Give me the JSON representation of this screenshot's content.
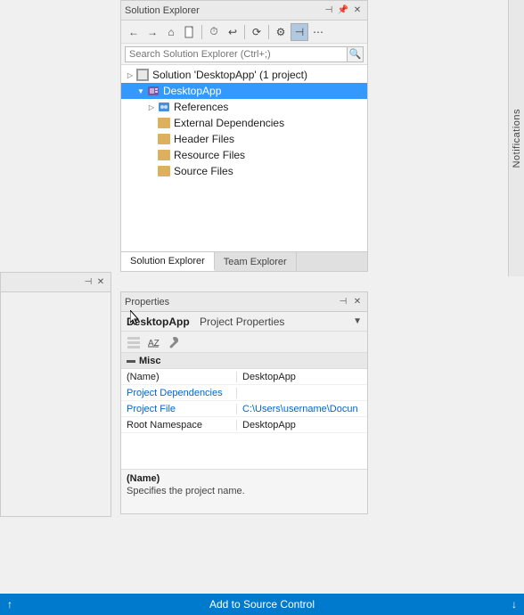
{
  "notifications": {
    "label": "Notifications"
  },
  "solutionExplorer": {
    "title": "Solution Explorer",
    "searchPlaceholder": "Search Solution Explorer (Ctrl+;)",
    "tree": {
      "solution": "Solution 'DesktopApp' (1 project)",
      "project": "DesktopApp",
      "references": "References",
      "externalDependencies": "External Dependencies",
      "headerFiles": "Header Files",
      "resourceFiles": "Resource Files",
      "sourceFiles": "Source Files"
    },
    "tabs": {
      "solutionExplorer": "Solution Explorer",
      "teamExplorer": "Team Explorer"
    }
  },
  "properties": {
    "panelTitle": "Properties",
    "objectName": "DesktopApp",
    "objectType": "Project Properties",
    "misc": {
      "label": "Misc",
      "name": {
        "key": "(Name)",
        "value": "DesktopApp"
      },
      "projectDependencies": {
        "key": "Project Dependencies",
        "value": ""
      },
      "projectFile": {
        "key": "Project File",
        "value": "C:\\Users\\username\\Docun"
      },
      "rootNamespace": {
        "key": "Root Namespace",
        "value": "DesktopApp"
      }
    },
    "description": {
      "title": "(Name)",
      "text": "Specifies the project name."
    }
  },
  "statusBar": {
    "arrowUp": "↑",
    "text": "Add to Source Control",
    "arrowDown": "↓"
  },
  "toolbar": {
    "back": "←",
    "forward": "→",
    "home": "⌂",
    "newFile": "📄",
    "clock": "⏱",
    "undo": "↩",
    "refresh": "⟳",
    "settings": "⚙",
    "pin": "📌",
    "pinSide": "⊣",
    "close": "✕",
    "searchBtn": "🔍"
  }
}
